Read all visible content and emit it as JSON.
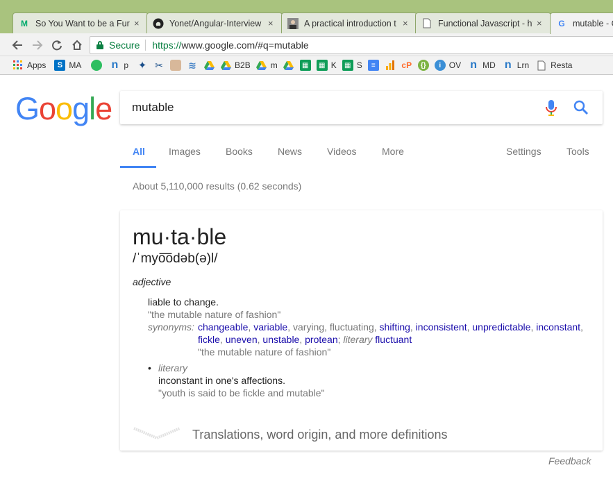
{
  "browser": {
    "tabs": [
      {
        "title": "So You Want to be a Fur",
        "favicon": "medium-icon"
      },
      {
        "title": "Yonet/Angular-Interview",
        "favicon": "github-icon"
      },
      {
        "title": "A practical introduction t",
        "favicon": "avatar-icon"
      },
      {
        "title": "Functional Javascript - ht",
        "favicon": "document-icon"
      },
      {
        "title": "mutable - G",
        "favicon": "google-icon"
      }
    ],
    "close_glyph": "×",
    "secure_label": "Secure",
    "url_scheme": "https://",
    "url_rest": "www.google.com/#q=mutable",
    "bookmarks": [
      {
        "label": "Apps"
      },
      {
        "label": "MA"
      },
      {
        "label": ""
      },
      {
        "label": "p"
      },
      {
        "label": ""
      },
      {
        "label": ""
      },
      {
        "label": ""
      },
      {
        "label": ""
      },
      {
        "label": ""
      },
      {
        "label": "B2B"
      },
      {
        "label": "m"
      },
      {
        "label": ""
      },
      {
        "label": ""
      },
      {
        "label": "K"
      },
      {
        "label": "S"
      },
      {
        "label": ""
      },
      {
        "label": ""
      },
      {
        "label": ""
      },
      {
        "label": ""
      },
      {
        "label": "OV"
      },
      {
        "label": "MD"
      },
      {
        "label": "Lrn"
      },
      {
        "label": "Resta"
      }
    ]
  },
  "search": {
    "logo": [
      "G",
      "o",
      "o",
      "g",
      "l",
      "e"
    ],
    "query": "mutable",
    "tabs": [
      "All",
      "Images",
      "Books",
      "News",
      "Videos",
      "More"
    ],
    "settings": "Settings",
    "tools": "Tools",
    "stats": "About 5,110,000 results (0.62 seconds)"
  },
  "dictionary": {
    "word": "mu·ta·ble",
    "pronunciation": "/ˈmyo͞odəb(ə)l/",
    "part_of_speech": "adjective",
    "definition_1": "liable to change.",
    "example_1": "\"the mutable nature of fashion\"",
    "synonyms_label": "synonyms:",
    "synonyms_line1": [
      {
        "text": "changeable",
        "link": true
      },
      {
        "text": "variable",
        "link": true
      },
      {
        "text": "varying",
        "link": false
      },
      {
        "text": "fluctuating",
        "link": false
      },
      {
        "text": "shifting",
        "link": true
      },
      {
        "text": "inconsistent",
        "link": true
      },
      {
        "text": "unpredictable",
        "link": true
      },
      {
        "text": "inconstant",
        "link": true
      }
    ],
    "synonyms_line2": [
      {
        "text": "fickle",
        "link": true
      },
      {
        "text": "uneven",
        "link": true
      },
      {
        "text": "unstable",
        "link": true
      },
      {
        "text": "protean",
        "link": true
      }
    ],
    "literary_label": "literary",
    "literary_synonym": "fluctuant",
    "synonyms_example": "\"the mutable nature of fashion\"",
    "bullet": "•",
    "register_2": "literary",
    "definition_2": "inconstant in one's affections.",
    "example_2": "\"youth is said to be fickle and mutable\"",
    "more_link": "Translations, word origin, and more definitions"
  },
  "feedback": "Feedback",
  "colors": {
    "google_blue": "#4285f4",
    "google_red": "#ea4335",
    "google_yellow": "#fbbc05",
    "google_green": "#34a853",
    "link": "#1a0dab",
    "secure_green": "#0b8043"
  }
}
